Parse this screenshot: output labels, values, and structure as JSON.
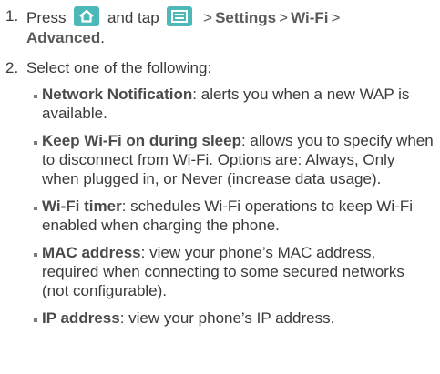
{
  "steps": [
    {
      "number": "1.",
      "text_press": "Press",
      "text_and_tap": "and tap",
      "home_icon": "home-icon",
      "menu_icon": "menu-icon",
      "sep": ">",
      "path": [
        "Settings",
        "Wi-Fi",
        "Advanced"
      ],
      "end": "."
    },
    {
      "number": "2.",
      "text": "Select one of the following:"
    }
  ],
  "options": [
    {
      "term": "Network Notification",
      "desc": ": alerts you when a new WAP is available."
    },
    {
      "term": "Keep Wi-Fi on during sleep",
      "desc": ": allows you to specify when to disconnect from Wi-Fi. Options are: Always, Only when plugged in, or Never (increase data usage)."
    },
    {
      "term": "Wi-Fi timer",
      "desc": ": schedules Wi-Fi operations to keep Wi-Fi enabled when charging the phone."
    },
    {
      "term": "MAC address",
      "desc": ": view your phone’s MAC address, required when connecting to some secured networks (not configurable)."
    },
    {
      "term": "IP address",
      "desc": ": view your phone’s IP address."
    }
  ],
  "colors": {
    "icon_bg": "#4db8b8",
    "text": "#3a3a3a"
  }
}
